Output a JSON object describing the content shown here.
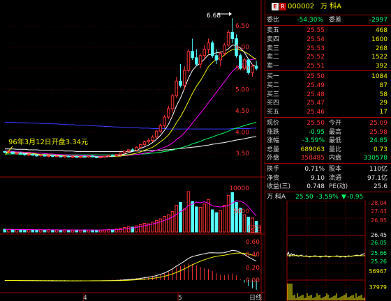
{
  "stock": {
    "badge": "E",
    "flag": "R",
    "code": "000002",
    "name": "万 科A"
  },
  "colors": {
    "up": "#ff3333",
    "down": "#54ffff",
    "ma5": "#ffffff",
    "ma10": "#f0f000",
    "ma20": "#ff00ff",
    "ma60": "#00ff66",
    "ma120": "#ffffff",
    "ma250": "#3a3aff",
    "grid": "#8b0000",
    "axis": "#ff3333"
  },
  "annotations": {
    "peak": "6.68",
    "note": "96年3月12日开盘3.34元"
  },
  "y_axis": {
    "price": [
      "6.50",
      "6.00",
      "5.50",
      "5.00",
      "4.50",
      "4.00",
      "3.50"
    ],
    "volume": [
      "10000",
      "5000"
    ],
    "volume_unit": "X10",
    "macd": [
      "0.60",
      "0.40",
      "0.20",
      "0.00"
    ]
  },
  "x_axis": {
    "months": [
      "4",
      "5"
    ],
    "period": "日线"
  },
  "chart_data": {
    "type": "candlestick",
    "price_range": [
      3.3,
      6.75
    ],
    "volume_range": [
      0,
      12000
    ],
    "candles": [
      [
        3.54,
        3.56,
        3.5,
        3.52
      ],
      [
        3.52,
        3.55,
        3.49,
        3.53
      ],
      [
        3.53,
        3.54,
        3.48,
        3.49
      ],
      [
        3.49,
        3.52,
        3.46,
        3.5
      ],
      [
        3.5,
        3.53,
        3.47,
        3.48
      ],
      [
        3.48,
        3.5,
        3.44,
        3.46
      ],
      [
        3.46,
        3.49,
        3.43,
        3.47
      ],
      [
        3.47,
        3.5,
        3.44,
        3.45
      ],
      [
        3.45,
        3.48,
        3.42,
        3.44
      ],
      [
        3.44,
        3.47,
        3.41,
        3.46
      ],
      [
        3.46,
        3.48,
        3.42,
        3.43
      ],
      [
        3.43,
        3.46,
        3.4,
        3.44
      ],
      [
        3.44,
        3.46,
        3.41,
        3.42
      ],
      [
        3.42,
        3.45,
        3.4,
        3.43
      ],
      [
        3.43,
        3.45,
        3.4,
        3.41
      ],
      [
        3.41,
        3.44,
        3.39,
        3.43
      ],
      [
        3.43,
        3.45,
        3.4,
        3.41
      ],
      [
        3.41,
        3.43,
        3.38,
        3.42
      ],
      [
        3.42,
        3.44,
        3.39,
        3.4
      ],
      [
        3.4,
        3.43,
        3.38,
        3.42
      ],
      [
        3.42,
        3.45,
        3.4,
        3.41
      ],
      [
        3.41,
        3.44,
        3.39,
        3.43
      ],
      [
        3.43,
        3.45,
        3.4,
        3.41
      ],
      [
        3.41,
        3.43,
        3.38,
        3.4
      ],
      [
        3.4,
        3.42,
        3.37,
        3.41
      ],
      [
        3.41,
        3.44,
        3.39,
        3.43
      ],
      [
        3.43,
        3.46,
        3.41,
        3.45
      ],
      [
        3.45,
        3.47,
        3.42,
        3.44
      ],
      [
        3.44,
        3.48,
        3.42,
        3.47
      ],
      [
        3.47,
        3.52,
        3.45,
        3.51
      ],
      [
        3.51,
        3.56,
        3.49,
        3.55
      ],
      [
        3.55,
        3.6,
        3.52,
        3.58
      ],
      [
        3.58,
        3.62,
        3.54,
        3.57
      ],
      [
        3.57,
        3.66,
        3.55,
        3.64
      ],
      [
        3.64,
        3.72,
        3.61,
        3.7
      ],
      [
        3.7,
        3.8,
        3.66,
        3.77
      ],
      [
        3.77,
        3.85,
        3.72,
        3.8
      ],
      [
        3.8,
        3.92,
        3.76,
        3.88
      ],
      [
        3.88,
        4.05,
        3.84,
        4.02
      ],
      [
        4.02,
        4.2,
        3.98,
        4.15
      ],
      [
        4.15,
        4.4,
        4.1,
        4.35
      ],
      [
        4.35,
        4.62,
        4.3,
        4.55
      ],
      [
        4.55,
        4.9,
        4.45,
        4.85
      ],
      [
        4.85,
        5.3,
        4.8,
        5.2
      ],
      [
        5.2,
        5.6,
        5.05,
        5.1
      ],
      [
        5.1,
        5.55,
        5.0,
        5.45
      ],
      [
        5.45,
        5.95,
        5.4,
        5.9
      ],
      [
        5.9,
        6.2,
        5.7,
        5.75
      ],
      [
        5.75,
        5.95,
        5.55,
        5.6
      ],
      [
        5.6,
        5.85,
        5.5,
        5.8
      ],
      [
        5.8,
        6.05,
        5.7,
        5.95
      ],
      [
        5.95,
        6.2,
        5.85,
        6.1
      ],
      [
        6.1,
        6.15,
        5.75,
        5.8
      ],
      [
        5.8,
        5.95,
        5.6,
        5.7
      ],
      [
        5.7,
        5.9,
        5.55,
        5.85
      ],
      [
        5.85,
        6.1,
        5.8,
        6.05
      ],
      [
        6.05,
        6.4,
        6.0,
        6.35
      ],
      [
        6.35,
        6.68,
        6.1,
        6.2
      ],
      [
        6.2,
        6.3,
        5.75,
        5.8
      ],
      [
        5.8,
        5.85,
        5.45,
        5.5
      ],
      [
        5.5,
        5.75,
        5.45,
        5.7
      ],
      [
        5.7,
        5.72,
        5.35,
        5.4
      ],
      [
        5.4,
        5.6,
        5.3,
        5.55
      ],
      [
        5.55,
        5.68,
        5.45,
        5.5
      ]
    ],
    "volumes": [
      700,
      650,
      600,
      620,
      580,
      560,
      600,
      540,
      520,
      560,
      500,
      540,
      510,
      520,
      490,
      530,
      500,
      480,
      510,
      470,
      520,
      500,
      490,
      470,
      480,
      520,
      600,
      560,
      700,
      900,
      1100,
      1300,
      1200,
      1500,
      1800,
      2100,
      2000,
      2400,
      2800,
      3200,
      3800,
      4200,
      5000,
      6500,
      7200,
      5600,
      9800,
      7400,
      6100,
      6000,
      6800,
      7900,
      5400,
      4700,
      5200,
      6500,
      8900,
      9600,
      7200,
      5800,
      4200,
      3600,
      3400,
      2600
    ],
    "ma5": [
      3.52,
      3.52,
      3.51,
      3.5,
      3.5,
      3.49,
      3.48,
      3.47,
      3.46,
      3.46,
      3.45,
      3.45,
      3.44,
      3.44,
      3.43,
      3.43,
      3.43,
      3.42,
      3.42,
      3.41,
      3.41,
      3.42,
      3.42,
      3.41,
      3.41,
      3.41,
      3.42,
      3.43,
      3.44,
      3.46,
      3.48,
      3.51,
      3.54,
      3.57,
      3.61,
      3.65,
      3.69,
      3.75,
      3.83,
      3.92,
      4.04,
      4.18,
      4.38,
      4.62,
      4.8,
      5.03,
      5.27,
      5.45,
      5.56,
      5.62,
      5.72,
      5.82,
      5.83,
      5.87,
      5.88,
      5.9,
      5.96,
      6.05,
      6.04,
      5.98,
      5.88,
      5.72,
      5.59,
      5.53
    ],
    "ma10": [
      3.53,
      3.53,
      3.52,
      3.51,
      3.51,
      3.5,
      3.5,
      3.49,
      3.48,
      3.47,
      3.47,
      3.46,
      3.45,
      3.45,
      3.44,
      3.44,
      3.43,
      3.43,
      3.43,
      3.42,
      3.42,
      3.42,
      3.42,
      3.42,
      3.41,
      3.41,
      3.42,
      3.42,
      3.43,
      3.43,
      3.45,
      3.46,
      3.48,
      3.5,
      3.53,
      3.57,
      3.6,
      3.64,
      3.7,
      3.77,
      3.84,
      3.93,
      4.06,
      4.22,
      4.36,
      4.53,
      4.72,
      4.91,
      5.08,
      5.21,
      5.37,
      5.54,
      5.64,
      5.71,
      5.75,
      5.81,
      5.89,
      5.94,
      5.95,
      5.93,
      5.89,
      5.84,
      5.77,
      5.71
    ],
    "ma20": [
      3.55,
      3.55,
      3.54,
      3.53,
      3.53,
      3.52,
      3.52,
      3.51,
      3.5,
      3.5,
      3.49,
      3.48,
      3.48,
      3.47,
      3.47,
      3.46,
      3.46,
      3.45,
      3.45,
      3.44,
      3.44,
      3.44,
      3.44,
      3.43,
      3.43,
      3.43,
      3.43,
      3.43,
      3.43,
      3.44,
      3.44,
      3.45,
      3.46,
      3.47,
      3.48,
      3.5,
      3.52,
      3.54,
      3.57,
      3.6,
      3.64,
      3.68,
      3.74,
      3.82,
      3.89,
      3.98,
      4.09,
      4.21,
      4.33,
      4.44,
      4.56,
      4.69,
      4.81,
      4.94,
      5.06,
      5.18,
      5.31,
      5.43,
      5.51,
      5.57,
      5.63,
      5.69,
      5.71,
      5.73
    ],
    "ma60": [
      3.48,
      3.48,
      3.48,
      3.48,
      3.47,
      3.47,
      3.47,
      3.47,
      3.47,
      3.47,
      3.46,
      3.46,
      3.46,
      3.46,
      3.46,
      3.46,
      3.46,
      3.46,
      3.46,
      3.46,
      3.46,
      3.46,
      3.46,
      3.46,
      3.46,
      3.46,
      3.46,
      3.46,
      3.46,
      3.46,
      3.46,
      3.47,
      3.47,
      3.47,
      3.48,
      3.48,
      3.49,
      3.5,
      3.51,
      3.52,
      3.54,
      3.55,
      3.57,
      3.6,
      3.62,
      3.65,
      3.68,
      3.72,
      3.75,
      3.78,
      3.82,
      3.85,
      3.88,
      3.92,
      3.95,
      3.98,
      4.02,
      4.06,
      4.09,
      4.12,
      4.15,
      4.18,
      4.2,
      4.23
    ],
    "ma120": [
      3.6,
      3.6,
      3.6,
      3.59,
      3.59,
      3.59,
      3.58,
      3.58,
      3.58,
      3.57,
      3.57,
      3.57,
      3.56,
      3.56,
      3.56,
      3.55,
      3.55,
      3.55,
      3.54,
      3.54,
      3.54,
      3.54,
      3.54,
      3.54,
      3.54,
      3.54,
      3.54,
      3.54,
      3.54,
      3.54,
      3.54,
      3.54,
      3.55,
      3.55,
      3.55,
      3.55,
      3.56,
      3.56,
      3.57,
      3.57,
      3.58,
      3.58,
      3.59,
      3.6,
      3.61,
      3.62,
      3.63,
      3.64,
      3.65,
      3.66,
      3.68,
      3.69,
      3.71,
      3.72,
      3.74,
      3.75,
      3.77,
      3.79,
      3.81,
      3.82,
      3.84,
      3.86,
      3.88,
      3.89
    ],
    "ma250": [
      4.23,
      4.23,
      4.23,
      4.22,
      4.22,
      4.22,
      4.21,
      4.21,
      4.21,
      4.2,
      4.2,
      4.2,
      4.19,
      4.19,
      4.18,
      4.18,
      4.17,
      4.17,
      4.16,
      4.16,
      4.16,
      4.15,
      4.15,
      4.14,
      4.14,
      4.13,
      4.13,
      4.12,
      4.12,
      4.11,
      4.11,
      4.1,
      4.1,
      4.1,
      4.09,
      4.09,
      4.09,
      4.08,
      4.08,
      4.08,
      4.08,
      4.07,
      4.07,
      4.07,
      4.07,
      4.07,
      4.07,
      4.07,
      4.07,
      4.07,
      4.07,
      4.07,
      4.07,
      4.07,
      4.07,
      4.07,
      4.07,
      4.08,
      4.08,
      4.08,
      4.08,
      4.08,
      4.09,
      4.09
    ],
    "vol_ma5": [
      640,
      630,
      620,
      615,
      600,
      590,
      585,
      570,
      560,
      555,
      545,
      540,
      530,
      525,
      515,
      510,
      505,
      500,
      495,
      495,
      500,
      500,
      495,
      490,
      490,
      500,
      520,
      545,
      580,
      650,
      750,
      870,
      1000,
      1150,
      1330,
      1530,
      1720,
      1940,
      2200,
      2480,
      2840,
      3200,
      3640,
      4300,
      4980,
      5500,
      6460,
      6760,
      7260,
      7090,
      7360,
      6980,
      6300,
      6200,
      6060,
      6250,
      6380,
      7040,
      7580,
      7480,
      7050,
      6120,
      4950,
      3920
    ],
    "macd_dif": [
      -0.005,
      -0.005,
      -0.006,
      -0.006,
      -0.007,
      -0.008,
      -0.008,
      -0.009,
      -0.01,
      -0.01,
      -0.011,
      -0.011,
      -0.012,
      -0.012,
      -0.012,
      -0.012,
      -0.012,
      -0.012,
      -0.012,
      -0.012,
      -0.011,
      -0.011,
      -0.01,
      -0.01,
      -0.01,
      -0.009,
      -0.008,
      -0.006,
      -0.004,
      -0.001,
      0.003,
      0.008,
      0.013,
      0.019,
      0.027,
      0.036,
      0.045,
      0.056,
      0.07,
      0.088,
      0.11,
      0.138,
      0.172,
      0.215,
      0.252,
      0.29,
      0.334,
      0.362,
      0.378,
      0.392,
      0.405,
      0.419,
      0.42,
      0.418,
      0.418,
      0.421,
      0.44,
      0.457,
      0.45,
      0.422,
      0.393,
      0.356,
      0.322,
      0.293
    ],
    "macd_dea": [
      -0.004,
      -0.004,
      -0.005,
      -0.005,
      -0.005,
      -0.006,
      -0.006,
      -0.007,
      -0.007,
      -0.008,
      -0.008,
      -0.009,
      -0.009,
      -0.01,
      -0.01,
      -0.01,
      -0.011,
      -0.011,
      -0.011,
      -0.011,
      -0.011,
      -0.011,
      -0.011,
      -0.011,
      -0.011,
      -0.01,
      -0.01,
      -0.009,
      -0.008,
      -0.007,
      -0.005,
      -0.002,
      0.001,
      0.005,
      0.009,
      0.014,
      0.02,
      0.027,
      0.036,
      0.046,
      0.059,
      0.075,
      0.094,
      0.118,
      0.145,
      0.174,
      0.206,
      0.237,
      0.265,
      0.29,
      0.313,
      0.334,
      0.351,
      0.365,
      0.375,
      0.384,
      0.395,
      0.407,
      0.415,
      0.417,
      0.412,
      0.401,
      0.385,
      0.367
    ],
    "macd_hist": [
      -0.002,
      -0.002,
      -0.002,
      -0.002,
      -0.004,
      -0.004,
      -0.004,
      -0.004,
      -0.006,
      -0.004,
      -0.006,
      -0.004,
      -0.006,
      -0.004,
      -0.004,
      -0.004,
      -0.002,
      -0.002,
      -0.002,
      -0.002,
      0.0,
      0.0,
      0.002,
      0.002,
      0.002,
      0.002,
      0.004,
      0.006,
      0.008,
      0.012,
      0.016,
      0.02,
      0.024,
      0.028,
      0.036,
      0.044,
      0.05,
      0.058,
      0.068,
      0.084,
      0.102,
      0.126,
      0.156,
      0.194,
      0.214,
      0.232,
      0.256,
      0.25,
      0.226,
      0.204,
      0.184,
      0.17,
      0.138,
      0.106,
      0.086,
      0.074,
      0.09,
      0.1,
      0.07,
      0.01,
      -0.038,
      -0.09,
      -0.126,
      -0.148
    ]
  },
  "quote": {
    "weibi_label": "委比",
    "weibi_value": "-54.30%",
    "weicha_label": "委差",
    "weicha_value": "-2997",
    "sell": [
      {
        "label": "卖五",
        "price": "25.55",
        "vol": "468"
      },
      {
        "label": "卖四",
        "price": "25.54",
        "vol": "1600"
      },
      {
        "label": "卖三",
        "price": "25.53",
        "vol": "268"
      },
      {
        "label": "卖二",
        "price": "25.52",
        "vol": "1522"
      },
      {
        "label": "卖一",
        "price": "25.51",
        "vol": "392"
      }
    ],
    "buy": [
      {
        "label": "买一",
        "price": "25.50",
        "vol": "1084"
      },
      {
        "label": "买二",
        "price": "25.49",
        "vol": "87"
      },
      {
        "label": "买三",
        "price": "25.48",
        "vol": "58"
      },
      {
        "label": "买四",
        "price": "25.47",
        "vol": "29"
      },
      {
        "label": "买五",
        "price": "25.46",
        "vol": "17"
      }
    ],
    "stats": [
      {
        "l1": "现价",
        "v1": "25.50",
        "c1": "red",
        "l2": "今开",
        "v2": "25.09",
        "c2": "red"
      },
      {
        "l1": "涨跌",
        "v1": "-0.95",
        "c1": "green",
        "l2": "最高",
        "v2": "25.98",
        "c2": "red"
      },
      {
        "l1": "涨幅",
        "v1": "-3.59%",
        "c1": "green",
        "l2": "最低",
        "v2": "24.85",
        "c2": "green"
      },
      {
        "l1": "总量",
        "v1": "689063",
        "c1": "yellow",
        "l2": "量比",
        "v2": "0.73",
        "c2": "yellow"
      },
      {
        "l1": "外盘",
        "v1": "358485",
        "c1": "red",
        "l2": "内盘",
        "v2": "330578",
        "c2": "green"
      }
    ],
    "stats2": [
      {
        "l1": "换手",
        "v1": "0.71%",
        "c1": "white",
        "l2": "股本",
        "v2": "110亿",
        "c2": "white"
      },
      {
        "l1": "净资",
        "v1": "9.10",
        "c1": "white",
        "l2": "流通",
        "v2": "97.1亿",
        "c2": "white"
      },
      {
        "l1": "收益(三)",
        "v1": "0.748",
        "c1": "white",
        "l2": "PE(动)",
        "v2": "25.6",
        "c2": "white"
      }
    ]
  },
  "mini": {
    "name": "万 科A",
    "price": "25.50",
    "change": "-3.59%",
    "delta": "-0.95",
    "axis_top": [
      "28.04",
      "27.43",
      "26.85",
      "26.45"
    ],
    "axis_mid": [
      "26.05",
      "25.66",
      "25.26"
    ],
    "axis_bottom": [
      "56967",
      "37979"
    ]
  }
}
